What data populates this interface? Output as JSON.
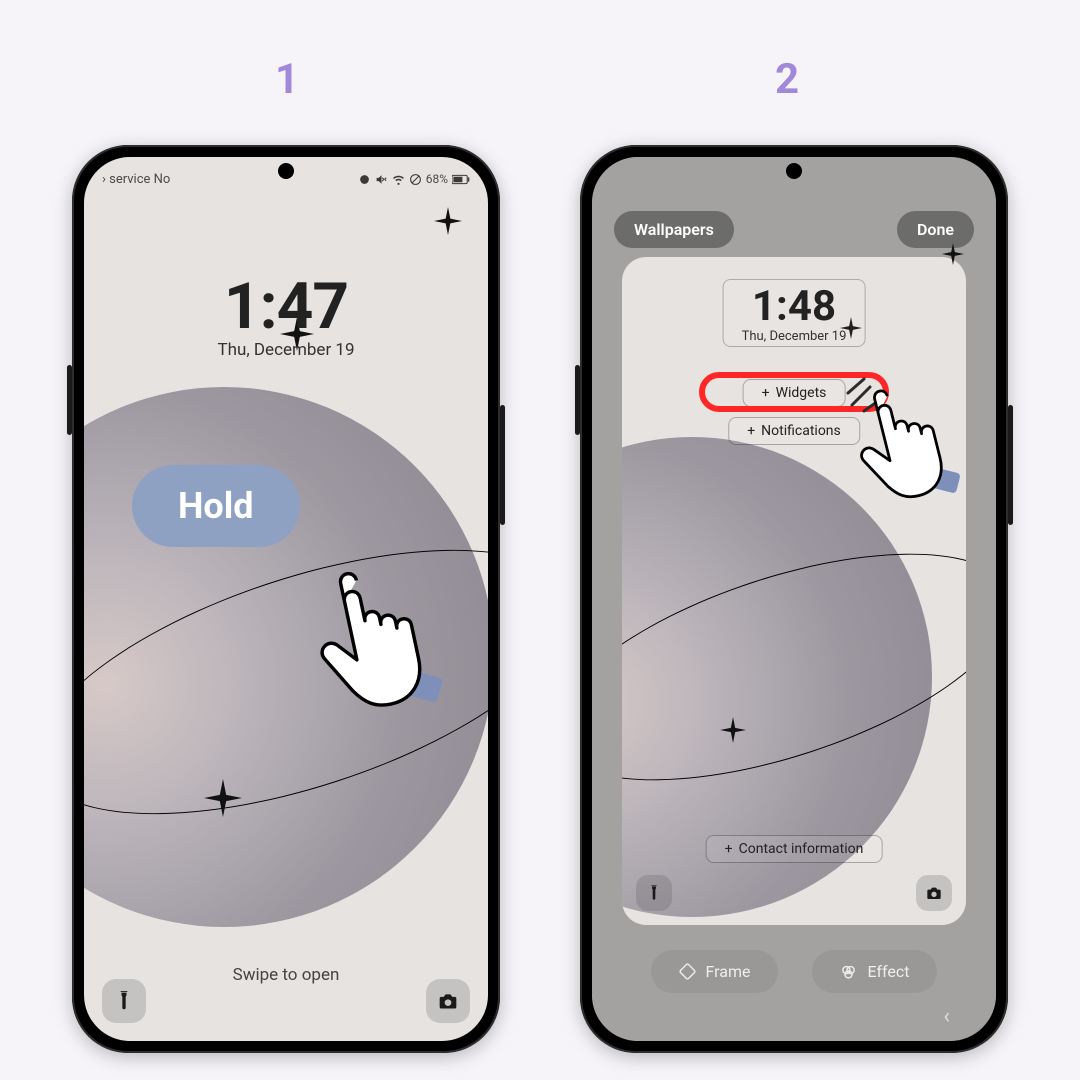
{
  "steps": {
    "one": "1",
    "two": "2"
  },
  "phone1": {
    "status_left": "› service    No",
    "battery": "68%",
    "time": "1:47",
    "date": "Thu, December 19",
    "swipe": "Swipe to open",
    "hold_label": "Hold"
  },
  "phone2": {
    "wallpapers": "Wallpapers",
    "done": "Done",
    "time": "1:48",
    "date": "Thu, December 19",
    "widgets": "Widgets",
    "notifications": "Notifications",
    "contact": "Contact information",
    "frame": "Frame",
    "effect": "Effect"
  },
  "glyphs": {
    "plus": "+"
  }
}
